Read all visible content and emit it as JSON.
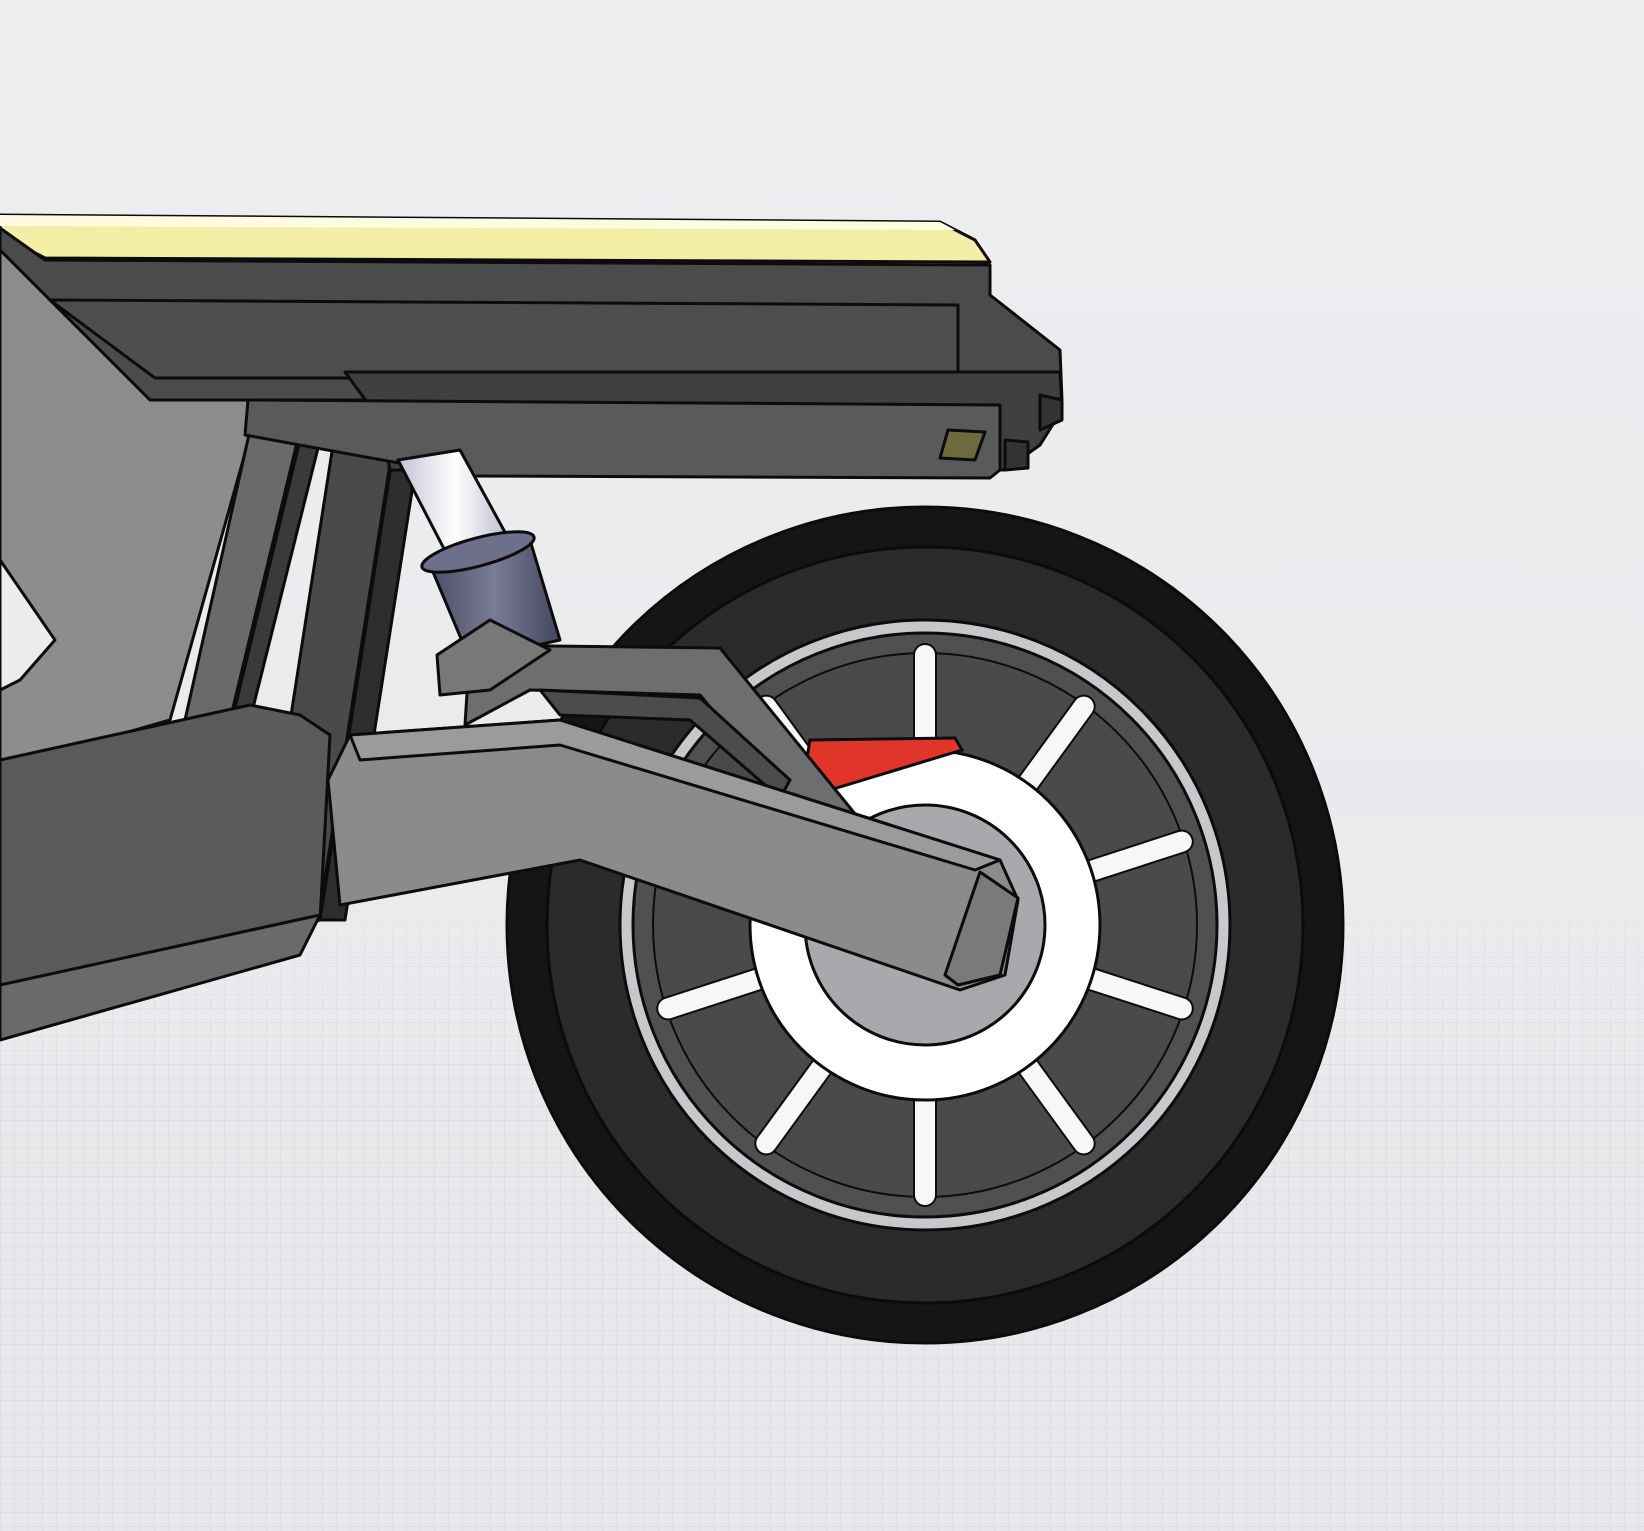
{
  "viewport": {
    "background_top": "#eeeef1",
    "background_floor": "#e6e6ea",
    "grid_color": "#c9c9d0"
  },
  "model": {
    "seat_color": "#f3eea6",
    "frame_dark": "#4c4c4c",
    "frame_mid": "#5a5a5a",
    "swingarm_color": "#8c8b8c",
    "tire_color": "#151515",
    "tire_inner": "#2b2b2b",
    "rim_color": "#c8c8cc",
    "spoke_color": "#f7f7f8",
    "hub_color": "#ffffff",
    "axle_color": "#a8a8ac",
    "shock_spring_color": "#5b5d78",
    "shock_body_color": "#d9d9e4",
    "brake_color": "#e0352b",
    "outline": "#0c0c0c",
    "spoke_count": 10
  }
}
